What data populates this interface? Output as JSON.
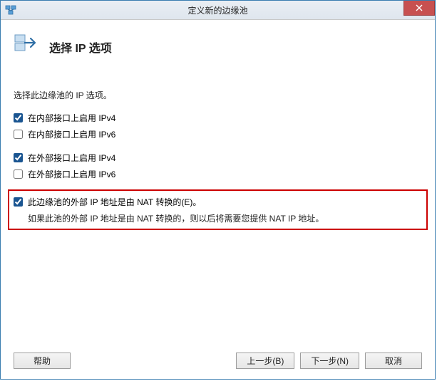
{
  "window": {
    "title": "定义新的边缘池"
  },
  "header": {
    "heading": "选择 IP 选项"
  },
  "instruction": "选择此边缘池的 IP 选项。",
  "options": {
    "internal_ipv4": {
      "label": "在内部接口上启用 IPv4",
      "checked": true
    },
    "internal_ipv6": {
      "label": "在内部接口上启用 IPv6",
      "checked": false
    },
    "external_ipv4": {
      "label": "在外部接口上启用 IPv4",
      "checked": true
    },
    "external_ipv6": {
      "label": "在外部接口上启用 IPv6",
      "checked": false
    },
    "nat": {
      "label": "此边缘池的外部 IP 地址是由 NAT 转换的(E)。",
      "checked": true,
      "note": "如果此池的外部 IP 地址是由 NAT 转换的，则以后将需要您提供 NAT IP 地址。"
    }
  },
  "buttons": {
    "help": "帮助",
    "back": "上一步(B)",
    "next": "下一步(N)",
    "cancel": "取消"
  }
}
